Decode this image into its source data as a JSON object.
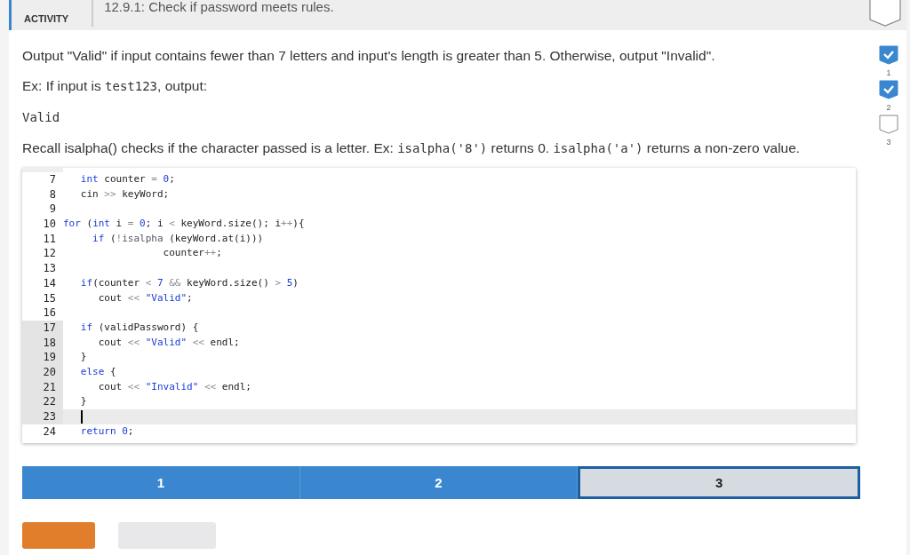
{
  "header": {
    "tag": "ACTIVITY",
    "title": "12.9.1: Check if password meets rules.",
    "completed": false
  },
  "levels": [
    {
      "number": "1",
      "checked": true
    },
    {
      "number": "2",
      "checked": true
    },
    {
      "number": "3",
      "checked": false
    }
  ],
  "instructions": [
    [
      {
        "kind": "text",
        "text": "Output \"Valid\" if input contains fewer than 7 letters and input's length is greater than 5. Otherwise, output \"Invalid\"."
      }
    ],
    [
      {
        "kind": "text",
        "text": "Ex: If input is "
      },
      {
        "kind": "code",
        "text": "test123"
      },
      {
        "kind": "text",
        "text": ", output:"
      }
    ],
    [
      {
        "kind": "code",
        "text": "Valid"
      }
    ],
    [
      {
        "kind": "text",
        "text": "Recall isalpha() checks if the character passed is a letter. Ex: "
      },
      {
        "kind": "code",
        "text": "isalpha('8')"
      },
      {
        "kind": "text",
        "text": " returns 0. "
      },
      {
        "kind": "code",
        "text": "isalpha('a')"
      },
      {
        "kind": "text",
        "text": " returns a non-zero value."
      }
    ]
  ],
  "editor": {
    "lines": [
      {
        "number": "7",
        "marked": false,
        "active": false,
        "tokens": [
          {
            "kind": "keyword",
            "text": "   int"
          },
          {
            "kind": "plain",
            "text": " counter"
          },
          {
            "kind": "operator",
            "text": " ="
          },
          {
            "kind": "number",
            "text": " 0"
          },
          {
            "kind": "plain",
            "text": ";"
          }
        ]
      },
      {
        "number": "8",
        "marked": false,
        "active": false,
        "tokens": [
          {
            "kind": "plain",
            "text": "   cin"
          },
          {
            "kind": "operator",
            "text": " >>"
          },
          {
            "kind": "plain",
            "text": " keyWord;"
          }
        ]
      },
      {
        "number": "9",
        "marked": false,
        "active": false
      },
      {
        "number": "10",
        "marked": false,
        "active": false,
        "tokens": [
          {
            "kind": "keyword",
            "text": "for"
          },
          {
            "kind": "plain",
            "text": " ("
          },
          {
            "kind": "keyword",
            "text": "int"
          },
          {
            "kind": "plain",
            "text": " i"
          },
          {
            "kind": "operator",
            "text": " ="
          },
          {
            "kind": "number",
            "text": " 0"
          },
          {
            "kind": "plain",
            "text": "; i"
          },
          {
            "kind": "operator",
            "text": " <"
          },
          {
            "kind": "plain",
            "text": " keyWord.size(); i"
          },
          {
            "kind": "operator",
            "text": "++"
          },
          {
            "kind": "plain",
            "text": "){"
          }
        ]
      },
      {
        "number": "11",
        "marked": false,
        "active": false,
        "tokens": [
          {
            "kind": "keyword",
            "text": "     if"
          },
          {
            "kind": "plain",
            "text": " ("
          },
          {
            "kind": "operator",
            "text": "!"
          },
          {
            "kind": "function",
            "text": "isalpha"
          },
          {
            "kind": "plain",
            "text": " (keyWord.at(i)))"
          }
        ]
      },
      {
        "number": "12",
        "marked": false,
        "active": false,
        "tokens": [
          {
            "kind": "plain",
            "text": "                 counter"
          },
          {
            "kind": "operator",
            "text": "++"
          },
          {
            "kind": "plain",
            "text": ";"
          }
        ]
      },
      {
        "number": "13",
        "marked": false,
        "active": false
      },
      {
        "number": "14",
        "marked": false,
        "active": false,
        "tokens": [
          {
            "kind": "keyword",
            "text": "   if"
          },
          {
            "kind": "plain",
            "text": "(counter"
          },
          {
            "kind": "operator",
            "text": " <"
          },
          {
            "kind": "number",
            "text": " 7"
          },
          {
            "kind": "operator",
            "text": " &&"
          },
          {
            "kind": "plain",
            "text": " keyWord.size()"
          },
          {
            "kind": "operator",
            "text": " >"
          },
          {
            "kind": "number",
            "text": " 5"
          },
          {
            "kind": "plain",
            "text": ")"
          }
        ]
      },
      {
        "number": "15",
        "marked": false,
        "active": false,
        "tokens": [
          {
            "kind": "plain",
            "text": "      cout"
          },
          {
            "kind": "operator",
            "text": " <<"
          },
          {
            "kind": "string",
            "text": " \"Valid\""
          },
          {
            "kind": "plain",
            "text": ";"
          }
        ]
      },
      {
        "number": "16",
        "marked": false,
        "active": false
      },
      {
        "number": "17",
        "marked": true,
        "active": false,
        "tokens": [
          {
            "kind": "keyword",
            "text": "   if"
          },
          {
            "kind": "plain",
            "text": " (validPassword) {"
          }
        ]
      },
      {
        "number": "18",
        "marked": true,
        "active": false,
        "tokens": [
          {
            "kind": "plain",
            "text": "      cout"
          },
          {
            "kind": "operator",
            "text": " <<"
          },
          {
            "kind": "string",
            "text": " \"Valid\""
          },
          {
            "kind": "operator",
            "text": " <<"
          },
          {
            "kind": "plain",
            "text": " endl;"
          }
        ]
      },
      {
        "number": "19",
        "marked": true,
        "active": false,
        "tokens": [
          {
            "kind": "plain",
            "text": "   }"
          }
        ]
      },
      {
        "number": "20",
        "marked": true,
        "active": false,
        "tokens": [
          {
            "kind": "keyword",
            "text": "   else"
          },
          {
            "kind": "plain",
            "text": " {"
          }
        ]
      },
      {
        "number": "21",
        "marked": true,
        "active": false,
        "tokens": [
          {
            "kind": "plain",
            "text": "      cout"
          },
          {
            "kind": "operator",
            "text": " <<"
          },
          {
            "kind": "string",
            "text": " \"Invalid\""
          },
          {
            "kind": "operator",
            "text": " <<"
          },
          {
            "kind": "plain",
            "text": " endl;"
          }
        ]
      },
      {
        "number": "22",
        "marked": true,
        "active": false,
        "tokens": [
          {
            "kind": "plain",
            "text": "   }"
          }
        ]
      },
      {
        "number": "23",
        "marked": true,
        "active": true
      },
      {
        "number": "24",
        "marked": false,
        "active": false,
        "tokens": [
          {
            "kind": "keyword",
            "text": "   return"
          },
          {
            "kind": "number",
            "text": " 0"
          },
          {
            "kind": "plain",
            "text": ";"
          }
        ]
      }
    ]
  },
  "steps": [
    {
      "label": "1",
      "done": true,
      "selected": false
    },
    {
      "label": "2",
      "done": true,
      "selected": false
    },
    {
      "label": "3",
      "done": false,
      "selected": true
    }
  ],
  "buttons": [
    {
      "kind": "primary"
    },
    {
      "kind": "disabled"
    }
  ]
}
